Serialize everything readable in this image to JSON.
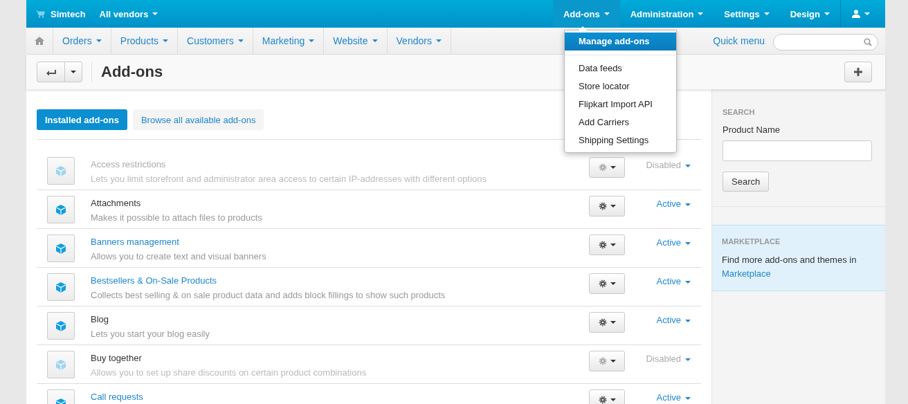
{
  "top_bar": {
    "brand": "Simtech",
    "vendor_menu": "All vendors",
    "menus": [
      {
        "label": "Add-ons",
        "selected": true
      },
      {
        "label": "Administration",
        "selected": false
      },
      {
        "label": "Settings",
        "selected": false
      },
      {
        "label": "Design",
        "selected": false
      }
    ]
  },
  "nav": {
    "items": [
      "Orders",
      "Products",
      "Customers",
      "Marketing",
      "Website",
      "Vendors"
    ],
    "quick_menu": "Quick menu"
  },
  "dropdown": {
    "groups": [
      [
        {
          "label": "Manage add-ons",
          "selected": true
        }
      ],
      [
        {
          "label": "Data feeds",
          "selected": false
        },
        {
          "label": "Store locator",
          "selected": false
        },
        {
          "label": "Flipkart Import API",
          "selected": false
        },
        {
          "label": "Add Carriers",
          "selected": false
        },
        {
          "label": "Shipping Settings",
          "selected": false
        }
      ]
    ]
  },
  "page": {
    "title": "Add-ons",
    "tabs": [
      {
        "label": "Installed add-ons",
        "selected": true
      },
      {
        "label": "Browse all available add-ons",
        "selected": false
      }
    ]
  },
  "addons": [
    {
      "name": "Access restrictions",
      "kind": "muted",
      "description": "Lets you limit storefront and administrator area access to certain IP-addresses with different options",
      "status": "Disabled",
      "active": false
    },
    {
      "name": "Attachments",
      "kind": "plain",
      "description": "Makes it possible to attach files to products",
      "status": "Active",
      "active": true
    },
    {
      "name": "Banners management",
      "kind": "link",
      "description": "Allows you to create text and visual banners",
      "status": "Active",
      "active": true
    },
    {
      "name": "Bestsellers & On-Sale Products",
      "kind": "link",
      "description": "Collects best selling & on sale product data and adds block fillings to show such products",
      "status": "Active",
      "active": true
    },
    {
      "name": "Blog",
      "kind": "plain",
      "description": "Lets you start your blog easily",
      "status": "Active",
      "active": true
    },
    {
      "name": "Buy together",
      "kind": "plain",
      "description": "Allows you to set up share discounts on certain product combinations",
      "status": "Disabled",
      "active": false
    },
    {
      "name": "Call requests",
      "kind": "link",
      "status": "Active",
      "active": true
    }
  ],
  "sidebar": {
    "search_heading": "SEARCH",
    "field_label": "Product Name",
    "button": "Search",
    "marketplace_heading": "MARKETPLACE",
    "marketplace_text": "Find more add-ons and themes in",
    "marketplace_link": "Marketplace"
  }
}
